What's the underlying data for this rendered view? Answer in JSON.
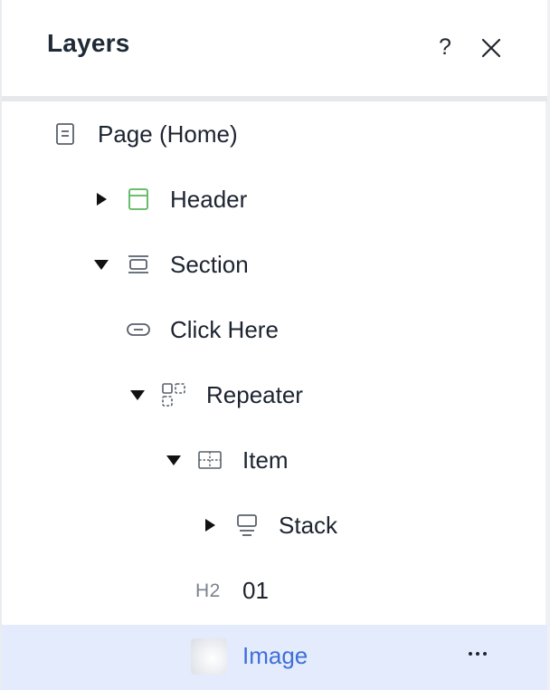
{
  "panel": {
    "title": "Layers",
    "help_label": "?"
  },
  "tree": {
    "items": [
      {
        "label": "Page (Home)",
        "icon": "page-icon"
      },
      {
        "label": "Header",
        "icon": "header-icon",
        "expanded": false
      },
      {
        "label": "Section",
        "icon": "section-icon",
        "expanded": true
      },
      {
        "label": "Click Here",
        "icon": "button-icon"
      },
      {
        "label": "Repeater",
        "icon": "repeater-icon",
        "expanded": true
      },
      {
        "label": "Item",
        "icon": "item-icon",
        "expanded": true
      },
      {
        "label": "Stack",
        "icon": "stack-icon",
        "expanded": false
      },
      {
        "label": "01",
        "tag": "H2"
      },
      {
        "label": "Image",
        "icon": "image-thumbnail",
        "selected": true
      }
    ]
  },
  "colors": {
    "selected_bg": "#e4ebfc",
    "selected_text": "#3f6fd8",
    "header_icon": "#5ab55e"
  }
}
